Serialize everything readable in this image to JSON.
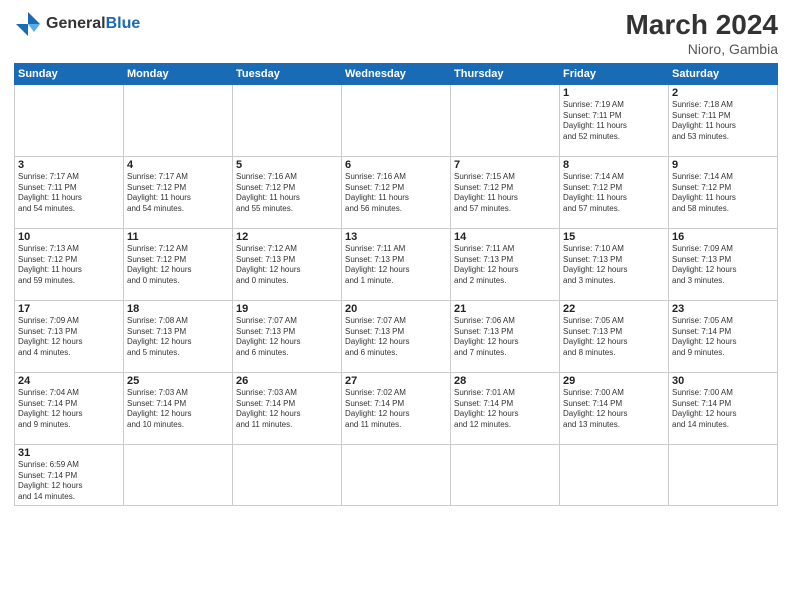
{
  "header": {
    "logo_general": "General",
    "logo_blue": "Blue",
    "month_year": "March 2024",
    "location": "Nioro, Gambia"
  },
  "days_of_week": [
    "Sunday",
    "Monday",
    "Tuesday",
    "Wednesday",
    "Thursday",
    "Friday",
    "Saturday"
  ],
  "weeks": [
    [
      {
        "date": "",
        "info": ""
      },
      {
        "date": "",
        "info": ""
      },
      {
        "date": "",
        "info": ""
      },
      {
        "date": "",
        "info": ""
      },
      {
        "date": "",
        "info": ""
      },
      {
        "date": "1",
        "info": "Sunrise: 7:19 AM\nSunset: 7:11 PM\nDaylight: 11 hours\nand 52 minutes."
      },
      {
        "date": "2",
        "info": "Sunrise: 7:18 AM\nSunset: 7:11 PM\nDaylight: 11 hours\nand 53 minutes."
      }
    ],
    [
      {
        "date": "3",
        "info": "Sunrise: 7:17 AM\nSunset: 7:11 PM\nDaylight: 11 hours\nand 54 minutes."
      },
      {
        "date": "4",
        "info": "Sunrise: 7:17 AM\nSunset: 7:12 PM\nDaylight: 11 hours\nand 54 minutes."
      },
      {
        "date": "5",
        "info": "Sunrise: 7:16 AM\nSunset: 7:12 PM\nDaylight: 11 hours\nand 55 minutes."
      },
      {
        "date": "6",
        "info": "Sunrise: 7:16 AM\nSunset: 7:12 PM\nDaylight: 11 hours\nand 56 minutes."
      },
      {
        "date": "7",
        "info": "Sunrise: 7:15 AM\nSunset: 7:12 PM\nDaylight: 11 hours\nand 57 minutes."
      },
      {
        "date": "8",
        "info": "Sunrise: 7:14 AM\nSunset: 7:12 PM\nDaylight: 11 hours\nand 57 minutes."
      },
      {
        "date": "9",
        "info": "Sunrise: 7:14 AM\nSunset: 7:12 PM\nDaylight: 11 hours\nand 58 minutes."
      }
    ],
    [
      {
        "date": "10",
        "info": "Sunrise: 7:13 AM\nSunset: 7:12 PM\nDaylight: 11 hours\nand 59 minutes."
      },
      {
        "date": "11",
        "info": "Sunrise: 7:12 AM\nSunset: 7:12 PM\nDaylight: 12 hours\nand 0 minutes."
      },
      {
        "date": "12",
        "info": "Sunrise: 7:12 AM\nSunset: 7:13 PM\nDaylight: 12 hours\nand 0 minutes."
      },
      {
        "date": "13",
        "info": "Sunrise: 7:11 AM\nSunset: 7:13 PM\nDaylight: 12 hours\nand 1 minute."
      },
      {
        "date": "14",
        "info": "Sunrise: 7:11 AM\nSunset: 7:13 PM\nDaylight: 12 hours\nand 2 minutes."
      },
      {
        "date": "15",
        "info": "Sunrise: 7:10 AM\nSunset: 7:13 PM\nDaylight: 12 hours\nand 3 minutes."
      },
      {
        "date": "16",
        "info": "Sunrise: 7:09 AM\nSunset: 7:13 PM\nDaylight: 12 hours\nand 3 minutes."
      }
    ],
    [
      {
        "date": "17",
        "info": "Sunrise: 7:09 AM\nSunset: 7:13 PM\nDaylight: 12 hours\nand 4 minutes."
      },
      {
        "date": "18",
        "info": "Sunrise: 7:08 AM\nSunset: 7:13 PM\nDaylight: 12 hours\nand 5 minutes."
      },
      {
        "date": "19",
        "info": "Sunrise: 7:07 AM\nSunset: 7:13 PM\nDaylight: 12 hours\nand 6 minutes."
      },
      {
        "date": "20",
        "info": "Sunrise: 7:07 AM\nSunset: 7:13 PM\nDaylight: 12 hours\nand 6 minutes."
      },
      {
        "date": "21",
        "info": "Sunrise: 7:06 AM\nSunset: 7:13 PM\nDaylight: 12 hours\nand 7 minutes."
      },
      {
        "date": "22",
        "info": "Sunrise: 7:05 AM\nSunset: 7:13 PM\nDaylight: 12 hours\nand 8 minutes."
      },
      {
        "date": "23",
        "info": "Sunrise: 7:05 AM\nSunset: 7:14 PM\nDaylight: 12 hours\nand 9 minutes."
      }
    ],
    [
      {
        "date": "24",
        "info": "Sunrise: 7:04 AM\nSunset: 7:14 PM\nDaylight: 12 hours\nand 9 minutes."
      },
      {
        "date": "25",
        "info": "Sunrise: 7:03 AM\nSunset: 7:14 PM\nDaylight: 12 hours\nand 10 minutes."
      },
      {
        "date": "26",
        "info": "Sunrise: 7:03 AM\nSunset: 7:14 PM\nDaylight: 12 hours\nand 11 minutes."
      },
      {
        "date": "27",
        "info": "Sunrise: 7:02 AM\nSunset: 7:14 PM\nDaylight: 12 hours\nand 11 minutes."
      },
      {
        "date": "28",
        "info": "Sunrise: 7:01 AM\nSunset: 7:14 PM\nDaylight: 12 hours\nand 12 minutes."
      },
      {
        "date": "29",
        "info": "Sunrise: 7:00 AM\nSunset: 7:14 PM\nDaylight: 12 hours\nand 13 minutes."
      },
      {
        "date": "30",
        "info": "Sunrise: 7:00 AM\nSunset: 7:14 PM\nDaylight: 12 hours\nand 14 minutes."
      }
    ],
    [
      {
        "date": "31",
        "info": "Sunrise: 6:59 AM\nSunset: 7:14 PM\nDaylight: 12 hours\nand 14 minutes."
      },
      {
        "date": "",
        "info": ""
      },
      {
        "date": "",
        "info": ""
      },
      {
        "date": "",
        "info": ""
      },
      {
        "date": "",
        "info": ""
      },
      {
        "date": "",
        "info": ""
      },
      {
        "date": "",
        "info": ""
      }
    ]
  ]
}
